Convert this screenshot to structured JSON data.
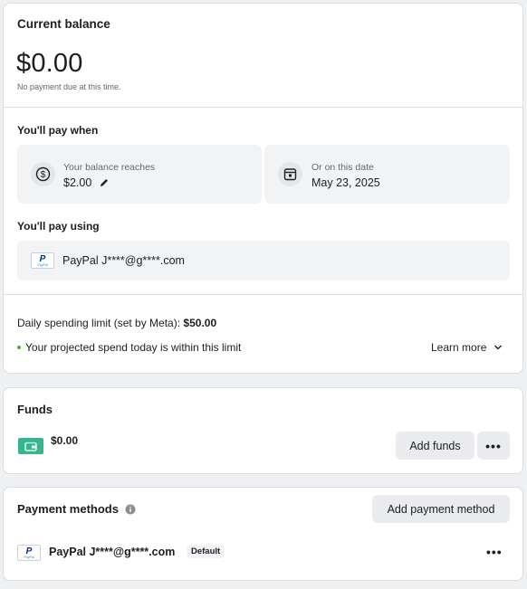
{
  "balance": {
    "title": "Current balance",
    "amount": "$0.00",
    "note": "No payment due at this time."
  },
  "pay_when": {
    "title": "You'll pay when",
    "threshold": {
      "label": "Your balance reaches",
      "value": "$2.00",
      "icon": "dollar-circle-icon"
    },
    "date": {
      "label": "Or on this date",
      "value": "May 23, 2025",
      "icon": "calendar-icon"
    }
  },
  "pay_using": {
    "title": "You'll pay using",
    "method": "PayPal J****@g****.com"
  },
  "spending_limit": {
    "label": "Daily spending limit (set by Meta):",
    "value": "$50.00",
    "status": "Your projected spend today is within this limit",
    "status_color": "#42b72a",
    "learn_more": "Learn more"
  },
  "funds": {
    "title": "Funds",
    "amount": "$0.00",
    "add_label": "Add funds",
    "more_label": "•••",
    "wallet_color": "#36b58f"
  },
  "payment_methods": {
    "title": "Payment methods",
    "add_label": "Add payment method",
    "items": [
      {
        "name": "PayPal J****@g****.com",
        "badge": "Default",
        "more_label": "•••"
      }
    ]
  },
  "paypal_logo": {
    "mark": "P",
    "text": "PayPal"
  }
}
